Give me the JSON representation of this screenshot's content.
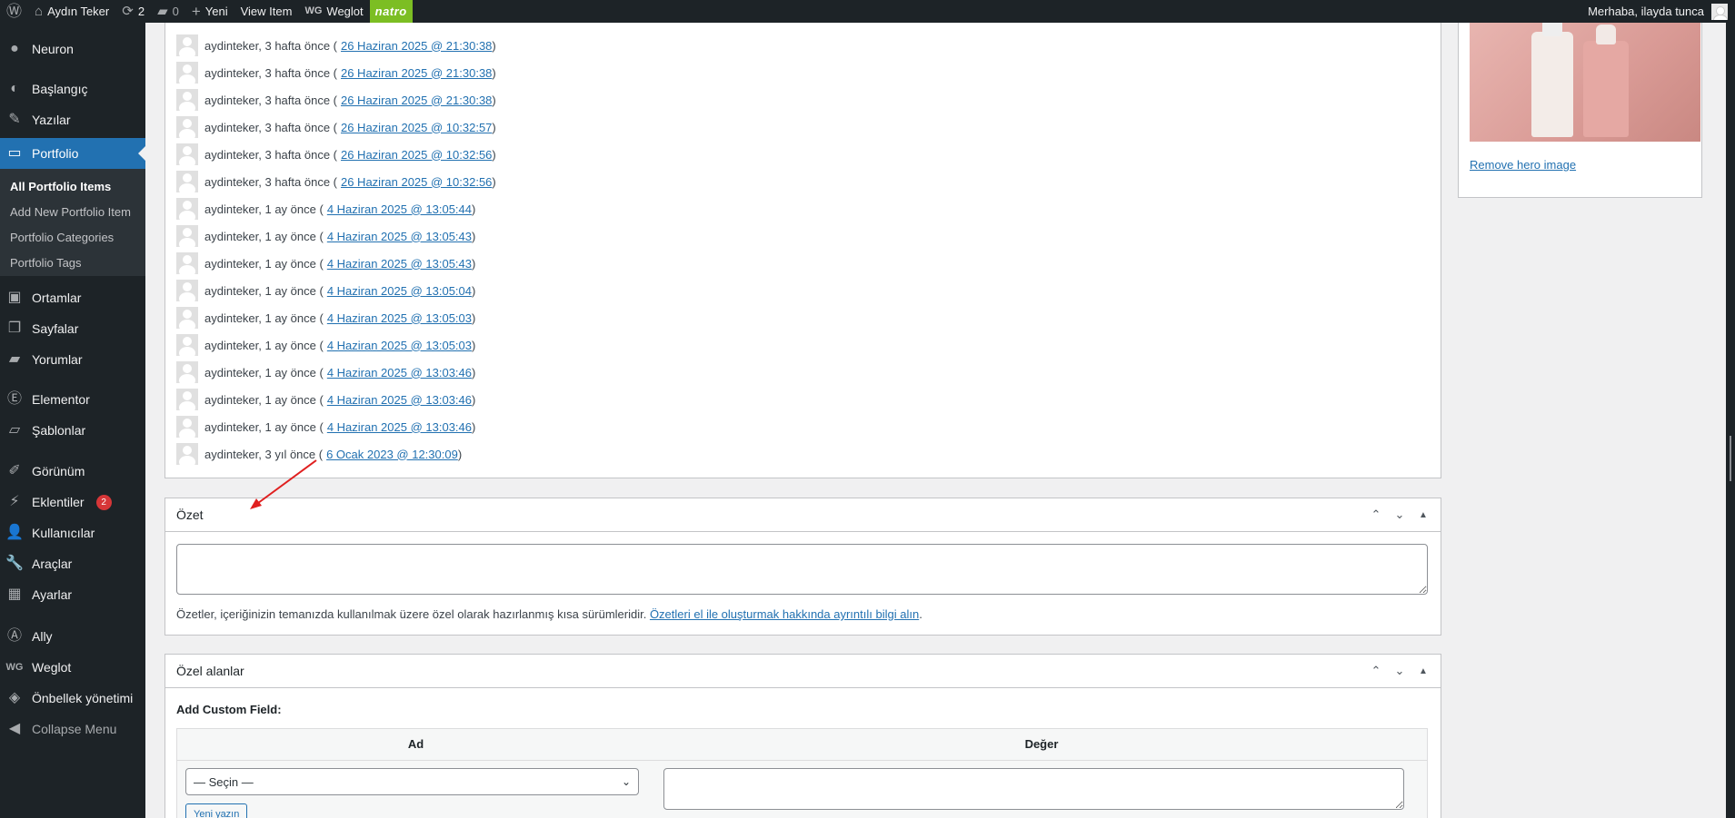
{
  "adminbar": {
    "site_name": "Aydın Teker",
    "updates_count": "2",
    "comments_count": "0",
    "new_label": "Yeni",
    "view_item_label": "View Item",
    "weglot_label": "Weglot",
    "natro_label": "natro",
    "greeting": "Merhaba, ilayda tunca"
  },
  "sidebar": {
    "items": [
      {
        "label": "Neuron",
        "icon": "neuron-icon"
      },
      {
        "label": "Başlangıç",
        "icon": "dashboard-icon"
      },
      {
        "label": "Yazılar",
        "icon": "pin-icon"
      },
      {
        "label": "Portfolio",
        "icon": "folder-icon"
      },
      {
        "label": "Ortamlar",
        "icon": "media-icon"
      },
      {
        "label": "Sayfalar",
        "icon": "pages-icon"
      },
      {
        "label": "Yorumlar",
        "icon": "comments-icon"
      },
      {
        "label": "Elementor",
        "icon": "elementor-icon"
      },
      {
        "label": "Şablonlar",
        "icon": "templates-icon"
      },
      {
        "label": "Görünüm",
        "icon": "appearance-icon"
      },
      {
        "label": "Eklentiler",
        "icon": "plugins-icon",
        "badge": "2"
      },
      {
        "label": "Kullanıcılar",
        "icon": "users-icon"
      },
      {
        "label": "Araçlar",
        "icon": "tools-icon"
      },
      {
        "label": "Ayarlar",
        "icon": "settings-icon"
      },
      {
        "label": "Ally",
        "icon": "ally-icon"
      },
      {
        "label": "Weglot",
        "icon": "weglot-icon"
      },
      {
        "label": "Önbellek yönetimi",
        "icon": "cache-icon"
      },
      {
        "label": "Collapse Menu",
        "icon": "collapse-icon"
      }
    ],
    "submenu": [
      "All Portfolio Items",
      "Add New Portfolio Item",
      "Portfolio Categories",
      "Portfolio Tags"
    ]
  },
  "revisions": [
    {
      "author": "aydinteker, 3 hafta önce (",
      "date": "26 Haziran 2025 @ 21:30:38",
      "close": ")"
    },
    {
      "author": "aydinteker, 3 hafta önce (",
      "date": "26 Haziran 2025 @ 21:30:38",
      "close": ")"
    },
    {
      "author": "aydinteker, 3 hafta önce (",
      "date": "26 Haziran 2025 @ 21:30:38",
      "close": ")"
    },
    {
      "author": "aydinteker, 3 hafta önce (",
      "date": "26 Haziran 2025 @ 10:32:57",
      "close": ")"
    },
    {
      "author": "aydinteker, 3 hafta önce (",
      "date": "26 Haziran 2025 @ 10:32:56",
      "close": ")"
    },
    {
      "author": "aydinteker, 3 hafta önce (",
      "date": "26 Haziran 2025 @ 10:32:56",
      "close": ")"
    },
    {
      "author": "aydinteker, 1 ay önce (",
      "date": "4 Haziran 2025 @ 13:05:44",
      "close": ")"
    },
    {
      "author": "aydinteker, 1 ay önce (",
      "date": "4 Haziran 2025 @ 13:05:43",
      "close": ")"
    },
    {
      "author": "aydinteker, 1 ay önce (",
      "date": "4 Haziran 2025 @ 13:05:43",
      "close": ")"
    },
    {
      "author": "aydinteker, 1 ay önce (",
      "date": "4 Haziran 2025 @ 13:05:04",
      "close": ")"
    },
    {
      "author": "aydinteker, 1 ay önce (",
      "date": "4 Haziran 2025 @ 13:05:03",
      "close": ")"
    },
    {
      "author": "aydinteker, 1 ay önce (",
      "date": "4 Haziran 2025 @ 13:05:03",
      "close": ")"
    },
    {
      "author": "aydinteker, 1 ay önce (",
      "date": "4 Haziran 2025 @ 13:03:46",
      "close": ")"
    },
    {
      "author": "aydinteker, 1 ay önce (",
      "date": "4 Haziran 2025 @ 13:03:46",
      "close": ")"
    },
    {
      "author": "aydinteker, 1 ay önce (",
      "date": "4 Haziran 2025 @ 13:03:46",
      "close": ")"
    },
    {
      "author": "aydinteker, 3 yıl önce (",
      "date": "6 Ocak 2023 @ 12:30:09",
      "close": ")"
    }
  ],
  "excerpt": {
    "title": "Özet",
    "value": "",
    "help_text": "Özetler, içeriğinizin temanızda kullanılmak üzere özel olarak hazırlanmış kısa sürümleridir. ",
    "help_link": "Özetleri el ile oluşturmak hakkında ayrıntılı bilgi alın",
    "help_end": "."
  },
  "custom_fields": {
    "title": "Özel alanlar",
    "add_label": "Add Custom Field:",
    "col_name": "Ad",
    "col_value": "Değer",
    "select_value": "— Seçin —",
    "add_button": "Yeni yazın"
  },
  "hero": {
    "remove_link": "Remove hero image"
  },
  "colors": {
    "admin_bg": "#1d2327",
    "accent": "#2271b1",
    "natro_green": "#7cbe23",
    "badge_red": "#d63638",
    "annotation_red": "#e02020"
  }
}
